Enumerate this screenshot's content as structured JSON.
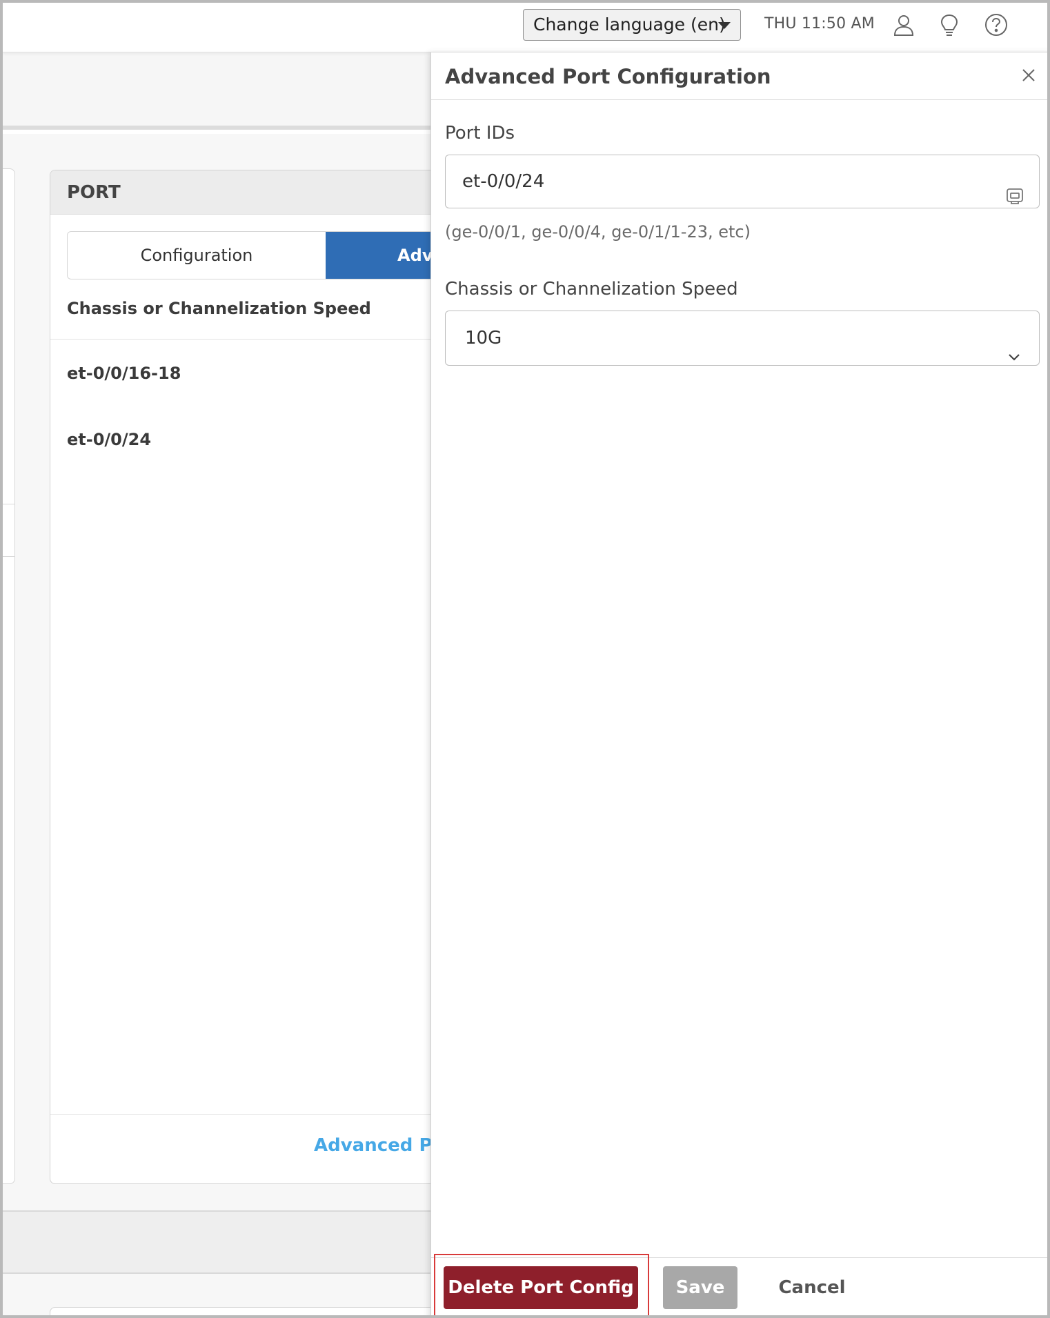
{
  "topbar": {
    "language_select": "Change language (en)",
    "clock": "THU 11:50 AM",
    "icons": [
      "user-icon",
      "lightbulb-icon",
      "help-icon"
    ]
  },
  "port_card": {
    "title": "PORT",
    "tabs": [
      "Configuration",
      "Adva"
    ],
    "column_header": "Chassis or Channelization Speed",
    "rows": [
      "et-0/0/16-18",
      "et-0/0/24"
    ],
    "link": "Advanced Por"
  },
  "drawer": {
    "title": "Advanced Port Configuration",
    "port_ids_label": "Port IDs",
    "port_ids_value": "et-0/0/24",
    "port_ids_hint": "(ge-0/0/1, ge-0/0/4, ge-0/1/1-23, etc)",
    "speed_label": "Chassis or Channelization Speed",
    "speed_value": "10G",
    "buttons": {
      "delete": "Delete Port Config",
      "save": "Save",
      "cancel": "Cancel"
    }
  },
  "colors": {
    "accent_blue": "#2f6db5",
    "link_blue": "#46a8e6",
    "delete_red": "#8e1f2b",
    "highlight_red": "#d83a3a",
    "disabled_gray": "#a8a8a8"
  }
}
